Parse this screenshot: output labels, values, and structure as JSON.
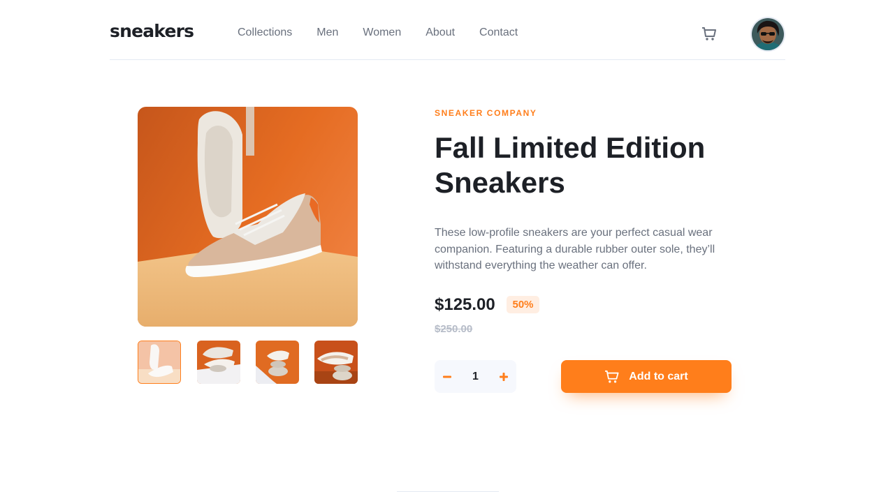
{
  "header": {
    "logo": "sneakers",
    "nav": [
      "Collections",
      "Men",
      "Women",
      "About",
      "Contact"
    ],
    "cart_icon": "cart-icon",
    "avatar_icon": "user-avatar"
  },
  "gallery": {
    "main_image": "sneaker-side-view-photo",
    "thumbnails": [
      "thumbnail-1",
      "thumbnail-2",
      "thumbnail-3",
      "thumbnail-4"
    ],
    "active_thumbnail": 0
  },
  "product": {
    "brand": "SNEAKER COMPANY",
    "title": "Fall Limited Edition Sneakers",
    "description": "These low-profile sneakers are your perfect casual wear companion. Featuring a durable rubber outer sole, they’ll withstand everything the weather can offer.",
    "price": "$125.00",
    "discount": "50%",
    "old_price": "$250.00"
  },
  "cart_controls": {
    "quantity": "1",
    "minus_icon": "minus-icon",
    "plus_icon": "plus-icon",
    "add_label": "Add to cart"
  },
  "colors": {
    "accent": "#ff7e1b",
    "accent_light": "#ffeee2",
    "dark": "#1d2026",
    "grey": "#69707d",
    "muted": "#b6bcc8",
    "light_bg": "#f6f8fd"
  }
}
